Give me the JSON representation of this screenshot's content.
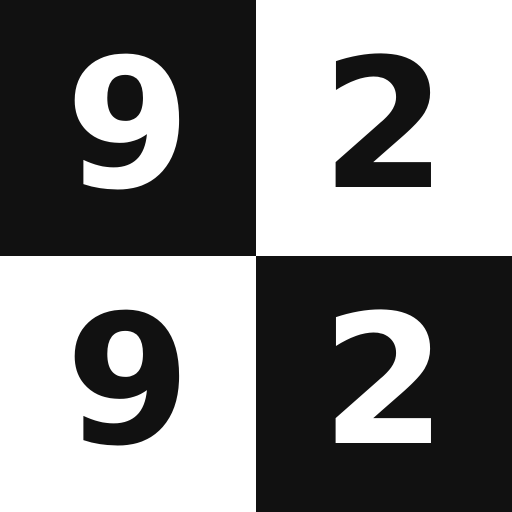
{
  "tiles": [
    {
      "value": "9",
      "theme": "dark"
    },
    {
      "value": "2",
      "theme": "light"
    },
    {
      "value": "9",
      "theme": "light"
    },
    {
      "value": "2",
      "theme": "dark"
    }
  ],
  "colors": {
    "dark": "#111111",
    "light": "#ffffff"
  }
}
